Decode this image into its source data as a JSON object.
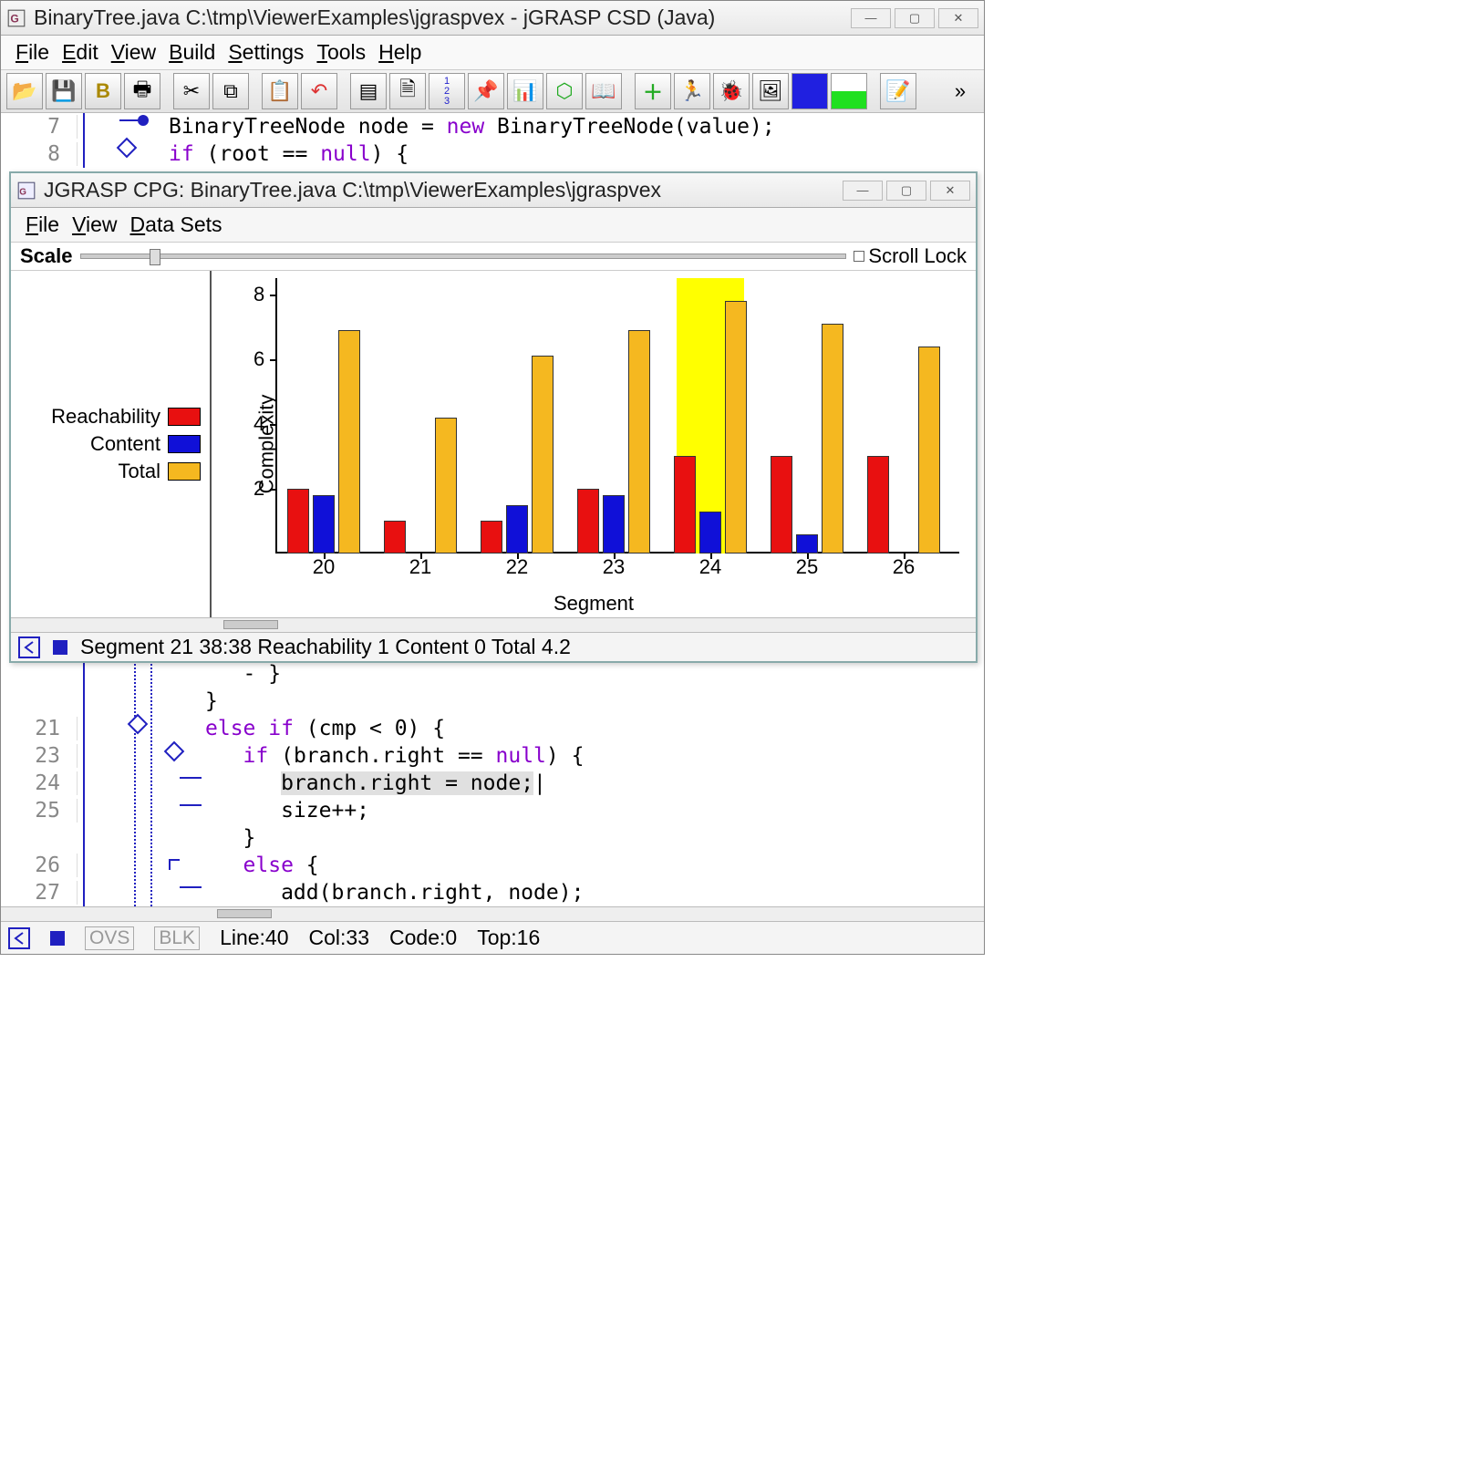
{
  "main_window": {
    "title": "BinaryTree.java  C:\\tmp\\ViewerExamples\\jgraspvex - jGRASP CSD (Java)",
    "menus": [
      "File",
      "Edit",
      "View",
      "Build",
      "Settings",
      "Tools",
      "Help"
    ],
    "code_top": {
      "lines": [
        {
          "num": "7",
          "text": "      BinaryTreeNode node = new BinaryTreeNode(value);"
        },
        {
          "num": "8",
          "text": "      if (root == null) {"
        }
      ]
    },
    "code_bottom": {
      "lines": [
        {
          "num": "",
          "text": "         - }"
        },
        {
          "num": "",
          "text": "      }"
        },
        {
          "num": "21",
          "text": "      else if (cmp < 0) {"
        },
        {
          "num": "23",
          "text": "         if (branch.right == null) {"
        },
        {
          "num": "24",
          "text": "            branch.right = node;"
        },
        {
          "num": "25",
          "text": "            size++;"
        },
        {
          "num": "",
          "text": "         }"
        },
        {
          "num": "26",
          "text": "         else {"
        },
        {
          "num": "27",
          "text": "            add(branch.right, node);"
        }
      ]
    },
    "status": {
      "ovs": "OVS",
      "blk": "BLK",
      "line": "Line:40",
      "col": "Col:33",
      "code": "Code:0",
      "top": "Top:16"
    }
  },
  "cpg_window": {
    "title": "JGRASP CPG:  BinaryTree.java  C:\\tmp\\ViewerExamples\\jgraspvex",
    "menus": [
      "File",
      "View",
      "Data Sets"
    ],
    "scale_label": "Scale",
    "scroll_lock": "Scroll Lock",
    "legend": [
      {
        "name": "Reachability",
        "color": "#e81010"
      },
      {
        "name": "Content",
        "color": "#1010d8"
      },
      {
        "name": "Total",
        "color": "#f5b820"
      }
    ],
    "ylabel": "Complexity",
    "xlabel": "Segment",
    "status": "Segment 21 38:38  Reachability 1  Content 0  Total 4.2"
  },
  "chart_data": {
    "type": "bar",
    "xlabel": "Segment",
    "ylabel": "Complexity",
    "ylim": [
      0,
      8.5
    ],
    "yticks": [
      2,
      4,
      6,
      8
    ],
    "categories": [
      "20",
      "21",
      "22",
      "23",
      "24",
      "25",
      "26"
    ],
    "highlighted_category": "24",
    "series": [
      {
        "name": "Reachability",
        "color": "#e81010",
        "values": [
          2.0,
          1.0,
          1.0,
          2.0,
          3.0,
          3.0,
          3.0
        ]
      },
      {
        "name": "Content",
        "color": "#1010d8",
        "values": [
          1.8,
          0.0,
          1.5,
          1.8,
          1.3,
          0.6,
          0.0
        ]
      },
      {
        "name": "Total",
        "color": "#f5b820",
        "values": [
          6.9,
          4.2,
          6.1,
          6.9,
          7.8,
          7.1,
          6.4
        ]
      }
    ]
  },
  "colors": {
    "red": "#e81010",
    "blue": "#1010d8",
    "orange": "#f5b820",
    "highlight": "#ffff00"
  }
}
